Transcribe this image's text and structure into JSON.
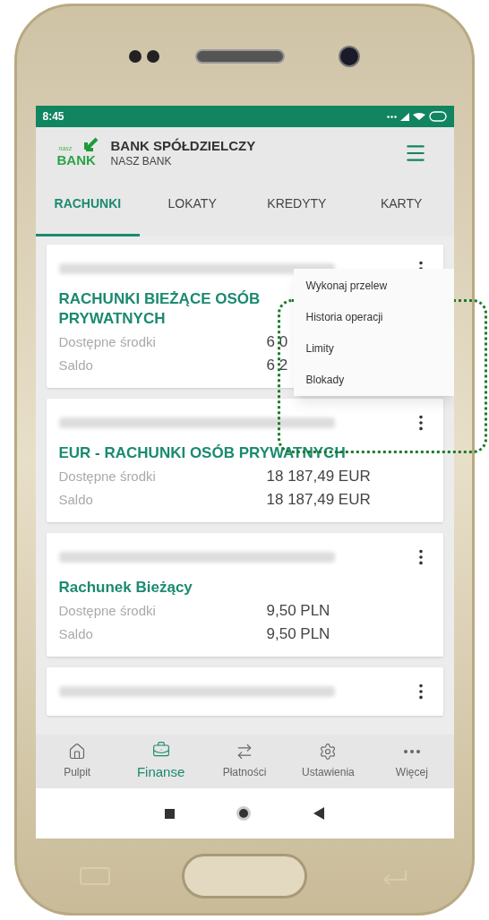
{
  "status_bar": {
    "time": "8:45"
  },
  "header": {
    "logo_small": "nasz",
    "logo_text": "BANK",
    "title": "BANK SPÓŁDZIELCZY",
    "subtitle": "NASZ BANK"
  },
  "tabs": [
    {
      "label": "RACHUNKI",
      "selected": true
    },
    {
      "label": "LOKATY",
      "selected": false
    },
    {
      "label": "KREDYTY",
      "selected": false
    },
    {
      "label": "KARTY",
      "selected": false
    }
  ],
  "accounts": [
    {
      "name": "RACHUNKI BIEŻĄCE OSÓB PRYWATNYCH",
      "menu_open": true,
      "rows": [
        {
          "label": "Dostępne środki",
          "value": "6 0"
        },
        {
          "label": "Saldo",
          "value": "6 2"
        }
      ]
    },
    {
      "name": "EUR - RACHUNKI OSÓB PRYWATNYCH",
      "menu_open": false,
      "rows": [
        {
          "label": "Dostępne środki",
          "value": "18 187,49 EUR"
        },
        {
          "label": "Saldo",
          "value": "18 187,49 EUR"
        }
      ]
    },
    {
      "name": "Rachunek Bieżący",
      "menu_open": false,
      "rows": [
        {
          "label": "Dostępne środki",
          "value": "9,50 PLN"
        },
        {
          "label": "Saldo",
          "value": "9,50 PLN"
        }
      ]
    },
    {
      "menu_open": false
    }
  ],
  "menu": [
    "Wykonaj przelew",
    "Historia operacji",
    "Limity",
    "Blokady"
  ],
  "bottom_nav": [
    {
      "label": "Pulpit",
      "selected": false
    },
    {
      "label": "Finanse",
      "selected": true
    },
    {
      "label": "Płatności",
      "selected": false
    },
    {
      "label": "Ustawienia",
      "selected": false
    },
    {
      "label": "Więcej",
      "selected": false
    }
  ]
}
